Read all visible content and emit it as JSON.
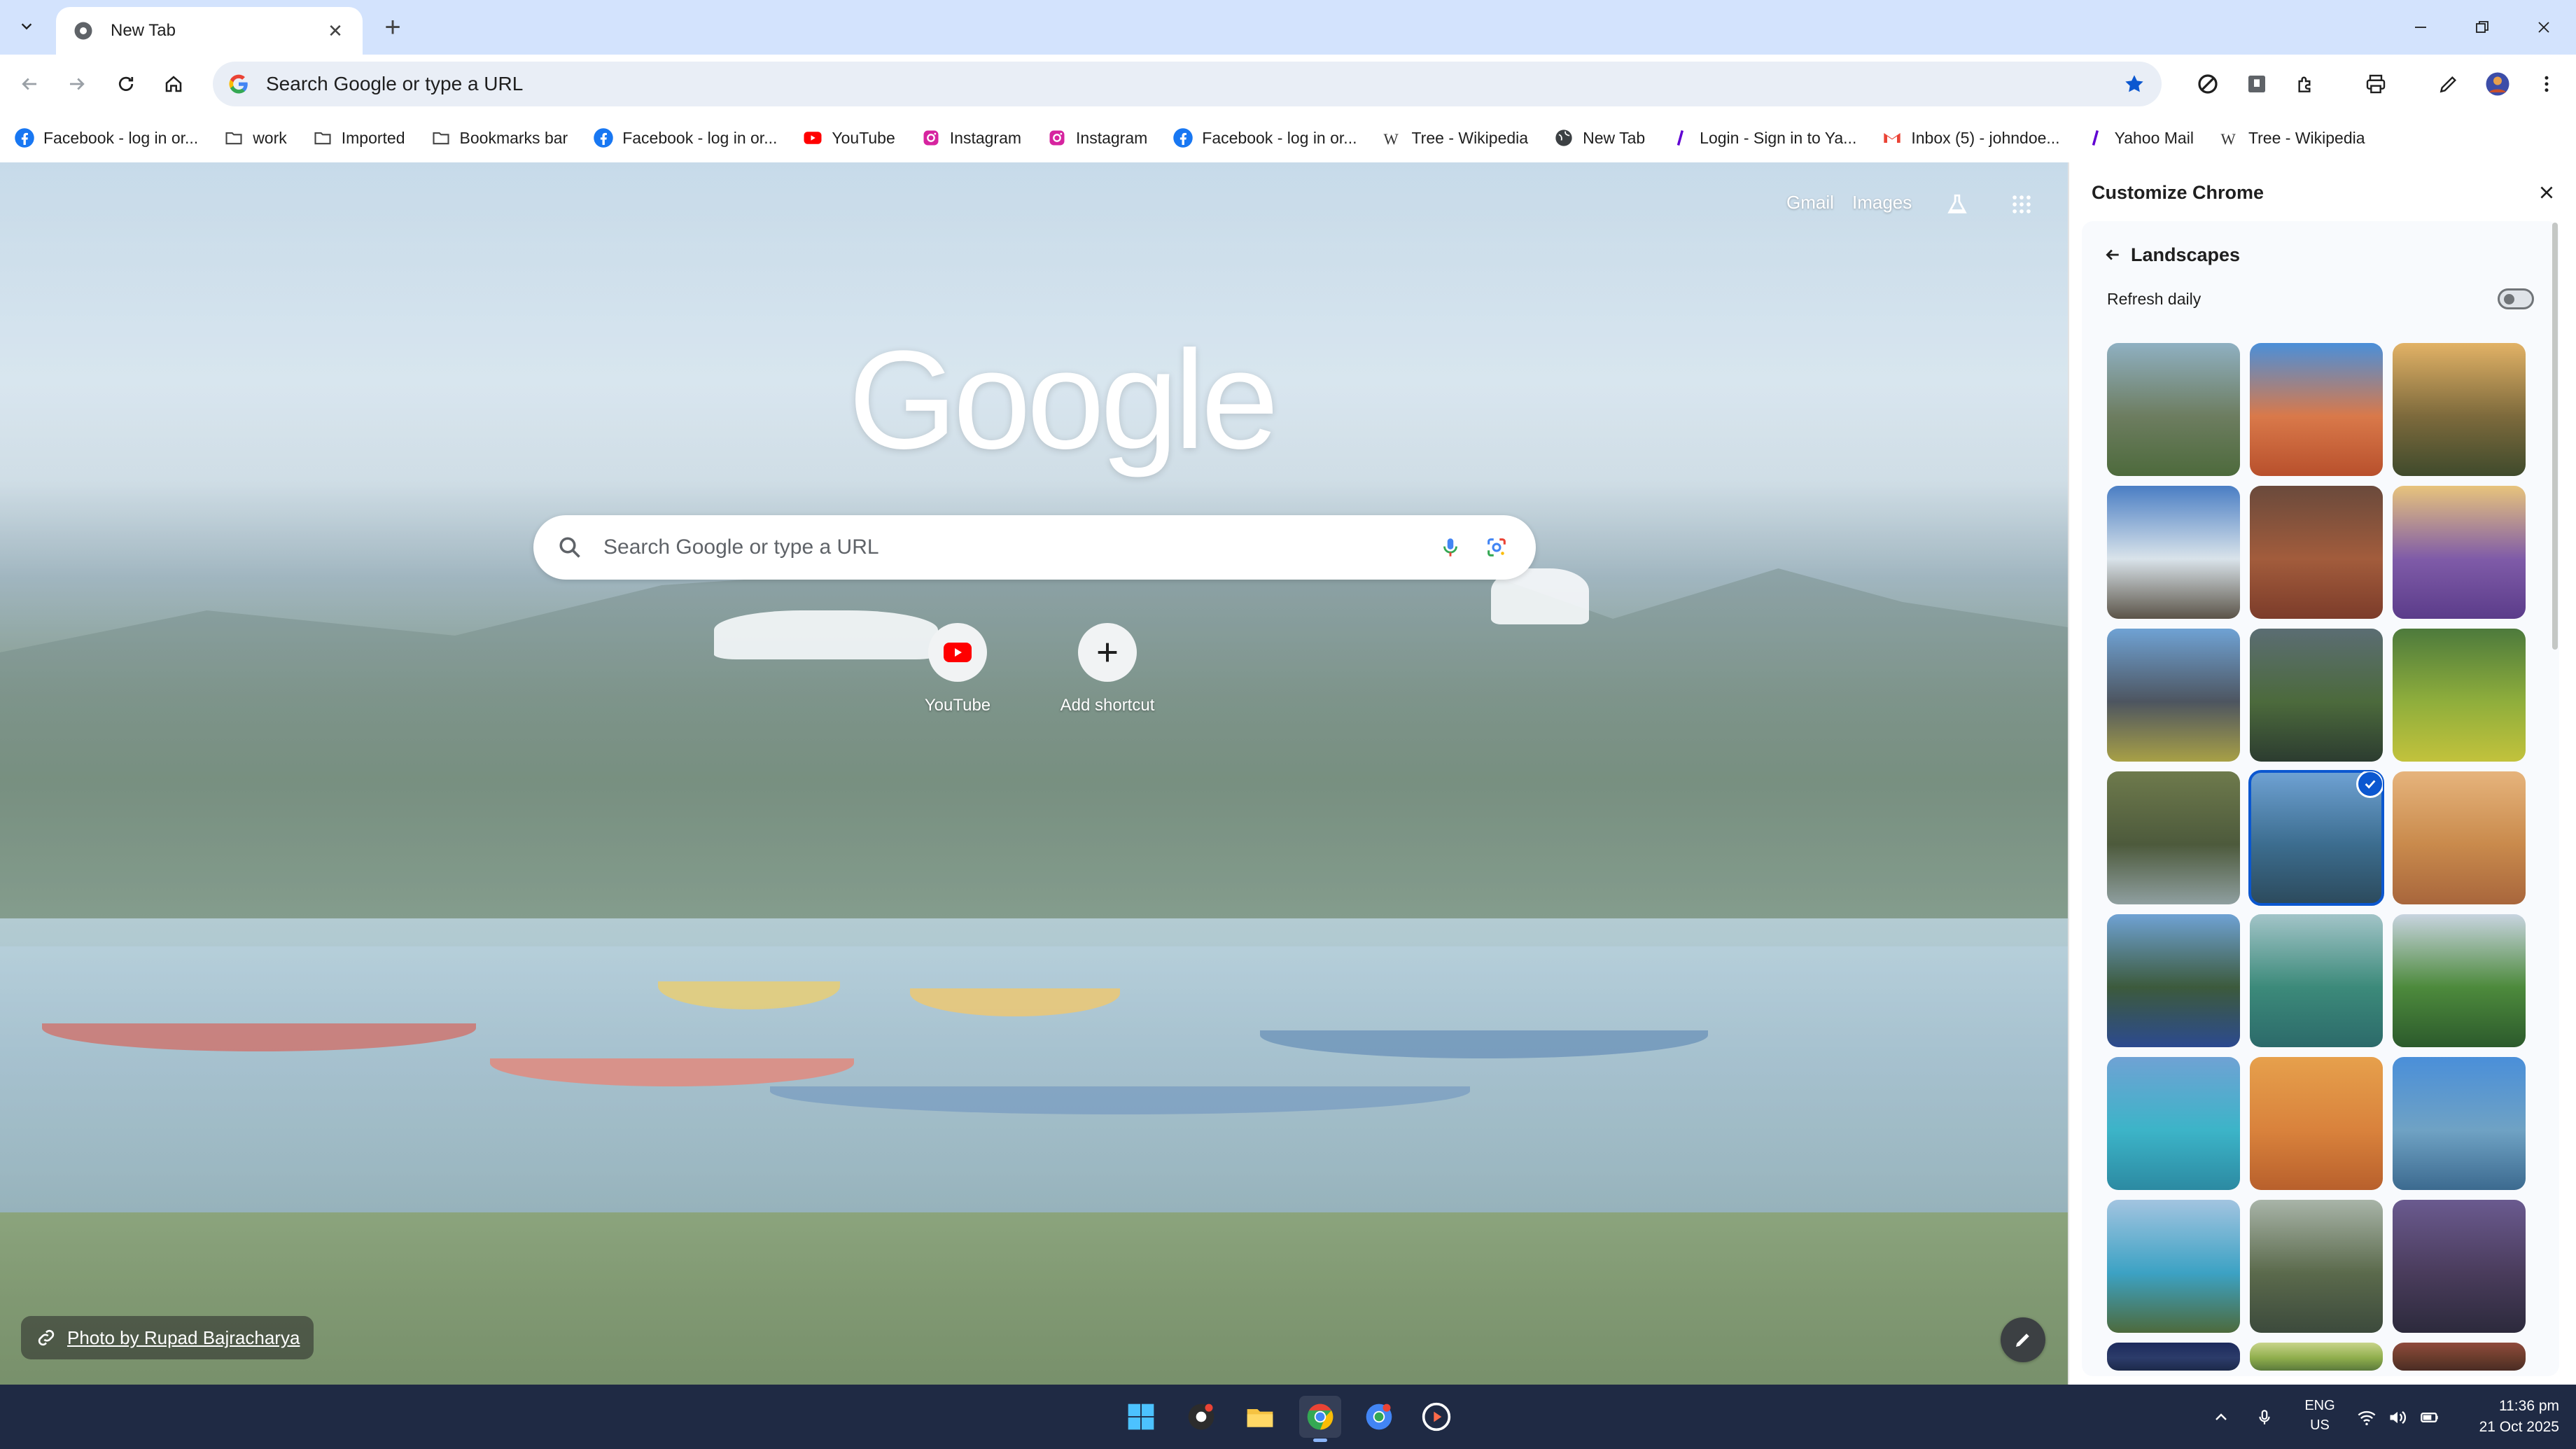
{
  "tab": {
    "title": "New Tab"
  },
  "omnibox": {
    "placeholder": "Search Google or type a URL"
  },
  "bookmarks": [
    {
      "label": "Facebook - log in or...",
      "icon": "facebook-icon"
    },
    {
      "label": "work",
      "icon": "folder-icon"
    },
    {
      "label": "Imported",
      "icon": "folder-icon"
    },
    {
      "label": "Bookmarks bar",
      "icon": "folder-icon"
    },
    {
      "label": "Facebook - log in or...",
      "icon": "facebook-icon"
    },
    {
      "label": "YouTube",
      "icon": "youtube-icon"
    },
    {
      "label": "Instagram",
      "icon": "instagram-icon"
    },
    {
      "label": "Instagram",
      "icon": "instagram-icon"
    },
    {
      "label": "Facebook - log in or...",
      "icon": "facebook-icon"
    },
    {
      "label": "Tree - Wikipedia",
      "icon": "wikipedia-icon"
    },
    {
      "label": "New Tab",
      "icon": "globe-icon"
    },
    {
      "label": "Login - Sign in to Ya...",
      "icon": "yahoo-icon"
    },
    {
      "label": "Inbox (5) - johndoe...",
      "icon": "gmail-icon"
    },
    {
      "label": "Yahoo Mail",
      "icon": "yahoo-icon"
    },
    {
      "label": "Tree - Wikipedia",
      "icon": "wikipedia-icon"
    }
  ],
  "ntp": {
    "gmail": "Gmail",
    "images": "Images",
    "logo": "Google",
    "search_placeholder": "Search Google or type a URL",
    "shortcuts": [
      {
        "label": "YouTube",
        "icon": "youtube-icon"
      },
      {
        "label": "Add shortcut",
        "icon": "plus-icon"
      }
    ],
    "attribution": "Photo by Rupad Bajracharya"
  },
  "side_panel": {
    "title": "Customize Chrome",
    "category": "Landscapes",
    "refresh_daily": "Refresh daily",
    "refresh_daily_on": false,
    "selected_index": 10,
    "thumbnails": [
      {
        "name": "rocky-lake",
        "colors": [
          "#8fb0c2",
          "#6d7d60",
          "#4d6a3c"
        ]
      },
      {
        "name": "red-arch",
        "colors": [
          "#4a8fd9",
          "#d9794a",
          "#b8502c"
        ]
      },
      {
        "name": "canyon-sunset",
        "colors": [
          "#e2b266",
          "#7d6a3c",
          "#3f4a2c"
        ]
      },
      {
        "name": "snowy-peaks",
        "colors": [
          "#4a7ec4",
          "#d9e3ea",
          "#5b5448"
        ]
      },
      {
        "name": "red-canyon",
        "colors": [
          "#6a4a3c",
          "#a25c3c",
          "#7c3c2a"
        ]
      },
      {
        "name": "lavender-field",
        "colors": [
          "#e8c47c",
          "#7f5ba8",
          "#5b3c8a"
        ]
      },
      {
        "name": "volcano-clouds",
        "colors": [
          "#6fa2d4",
          "#4d5560",
          "#a8a046"
        ]
      },
      {
        "name": "valley-river",
        "colors": [
          "#5b6d73",
          "#4c6a3c",
          "#2c3c30"
        ]
      },
      {
        "name": "rice-terraces",
        "colors": [
          "#4d7a3c",
          "#8fae3c",
          "#c2c23c"
        ]
      },
      {
        "name": "coastal-rocks",
        "colors": [
          "#6e7a4c",
          "#4d5a3c",
          "#8f9fa0"
        ]
      },
      {
        "name": "mountain-lake",
        "colors": [
          "#6fa2d4",
          "#3c6d8f",
          "#2c4a5c"
        ]
      },
      {
        "name": "sand-dunes",
        "colors": [
          "#e6b47c",
          "#c98a4c",
          "#a8663c"
        ]
      },
      {
        "name": "sea-cliffs",
        "colors": [
          "#6fa2d4",
          "#3c5a3c",
          "#2c4a8f"
        ]
      },
      {
        "name": "green-lake",
        "colors": [
          "#a2c4c8",
          "#3c8a7a",
          "#2c6a6a"
        ]
      },
      {
        "name": "waterfall-valley",
        "colors": [
          "#c8d4e0",
          "#4d8a3c",
          "#2c5a2c"
        ]
      },
      {
        "name": "turquoise-bay",
        "colors": [
          "#6fa2d4",
          "#3cb4c8",
          "#2c8aa2"
        ]
      },
      {
        "name": "orange-dunes",
        "colors": [
          "#e6a04c",
          "#d9823c",
          "#b8602c"
        ]
      },
      {
        "name": "calm-lake",
        "colors": [
          "#4a8fd9",
          "#6fa2c4",
          "#3c6a8f"
        ]
      },
      {
        "name": "alpine-lake",
        "colors": [
          "#a2c4e0",
          "#3ca2c4",
          "#4d6a3c"
        ]
      },
      {
        "name": "machu-picchu",
        "colors": [
          "#a8b4a8",
          "#5b6a4c",
          "#3c4a3c"
        ]
      },
      {
        "name": "purple-shore",
        "colors": [
          "#6a5a8f",
          "#4a3c5c",
          "#2c2a3c"
        ]
      },
      {
        "name": "night-sky",
        "colors": [
          "#1c2a5c",
          "#2c3c6a",
          "#1c2a4a"
        ]
      },
      {
        "name": "green-hills",
        "colors": [
          "#c8d48a",
          "#8fae4c",
          "#5b7a3c"
        ]
      },
      {
        "name": "red-rock",
        "colors": [
          "#8f4a3c",
          "#6a3c2c",
          "#4a2c24"
        ]
      }
    ]
  },
  "taskbar": {
    "lang_top": "ENG",
    "lang_bottom": "US",
    "time": "11:36 pm",
    "date": "21 Oct 2025"
  },
  "colors": {
    "tabbar": "#d3e3fd",
    "accent": "#0b57d0",
    "taskbar": "#1f2a44"
  }
}
